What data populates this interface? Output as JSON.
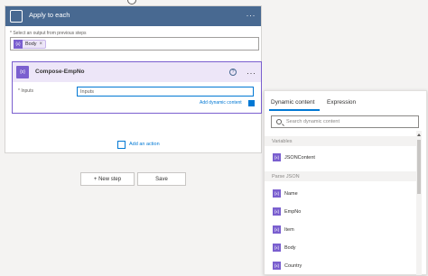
{
  "apply_each": {
    "title": "Apply to each",
    "more_label": "···",
    "select_label": "* Select an output from previous steps",
    "token_icon": "{x}",
    "token_label": "Body",
    "token_remove": "×"
  },
  "compose": {
    "icon_text": "{x}",
    "title": "Compose-EmpNo",
    "help_label": "?",
    "more_label": "···",
    "inputs_label": "* Inputs",
    "inputs_value": "Inputs",
    "add_dynamic_label": "Add dynamic content",
    "add_dynamic_badge": "+"
  },
  "add_action_label": "Add an action",
  "buttons": {
    "new_step": "+ New step",
    "save": "Save"
  },
  "panel": {
    "tabs": [
      "Dynamic content",
      "Expression"
    ],
    "search_placeholder": "Search dynamic content",
    "groups": [
      {
        "label": "Variables"
      },
      {
        "label": "Parse JSON"
      }
    ],
    "variables": [
      {
        "icon": "{x}",
        "label": "JSONContent"
      }
    ],
    "parse_json": [
      {
        "icon": "{x}",
        "label": "Name"
      },
      {
        "icon": "{x}",
        "label": "EmpNo"
      },
      {
        "icon": "{x}",
        "label": "Item"
      },
      {
        "icon": "{x}",
        "label": "Body"
      },
      {
        "icon": "{x}",
        "label": "Country"
      }
    ]
  },
  "colors": {
    "loop_header": "#486991",
    "compose_accent": "#7a5fcf",
    "compose_header_bg": "#ede6f8",
    "link_blue": "#0078d4"
  },
  "icons": {
    "loop": "loop-icon",
    "variable": "variable-icon",
    "help": "help-icon",
    "search": "search-icon",
    "add_action": "add-action-icon"
  }
}
